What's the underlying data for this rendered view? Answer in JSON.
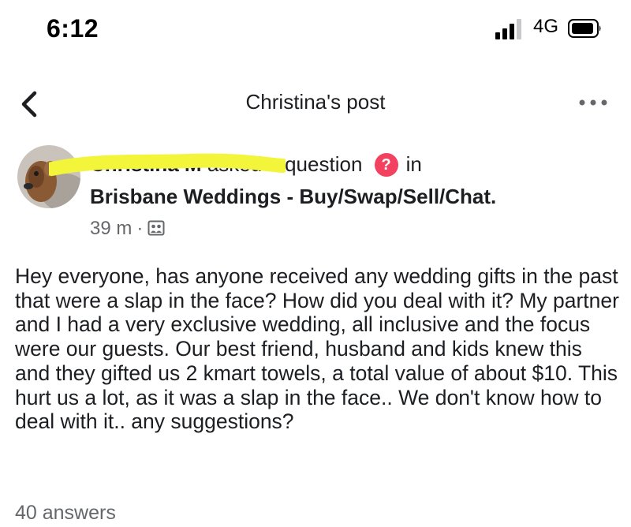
{
  "status_bar": {
    "time": "6:12",
    "network": "4G",
    "icons": [
      "signal-icon",
      "battery-icon"
    ]
  },
  "nav": {
    "title": "Christina's post",
    "back_icon": "chevron-left-icon",
    "more_icon": "more-horizontal-icon"
  },
  "post": {
    "author_name": "Christina M",
    "action_text": "asked a question",
    "question_badge": "?",
    "in_text": "in",
    "group_name": "Brisbane Weddings - Buy/Swap/Sell/Chat.",
    "time_ago": "39 m",
    "separator": "·",
    "audience_icon": "group-audience-icon",
    "body": "Hey everyone, has anyone received any wedding gifts in the past that were a slap in the face? How did you deal with it? My partner and I had a very exclusive wedding, all inclusive and the focus were our guests. Our best friend, husband and kids knew this and they gifted us 2 kmart towels, a total value of about $10. This hurt us a lot, as it was a slap in the face.. We don't know how to deal with it.. any suggestions?",
    "answers_count": "40 answers"
  },
  "colors": {
    "redaction": "#f2f53a",
    "question_badge": "#f3425f",
    "secondary_text": "#65676b"
  }
}
